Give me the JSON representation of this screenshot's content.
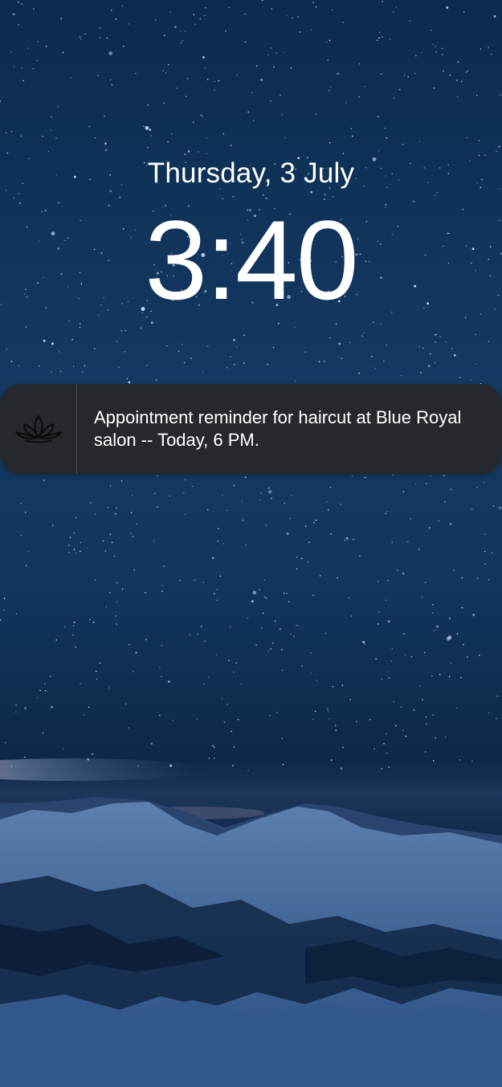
{
  "lockscreen": {
    "date": "Thursday, 3 July",
    "time": "3:40"
  },
  "notification": {
    "icon": "lotus-icon",
    "text": "Appointment reminder for haircut at Blue Royal salon -- Today, 6 PM."
  },
  "colors": {
    "sky": "#0f3258",
    "notification_bg": "#26272b",
    "text": "#ffffff"
  }
}
